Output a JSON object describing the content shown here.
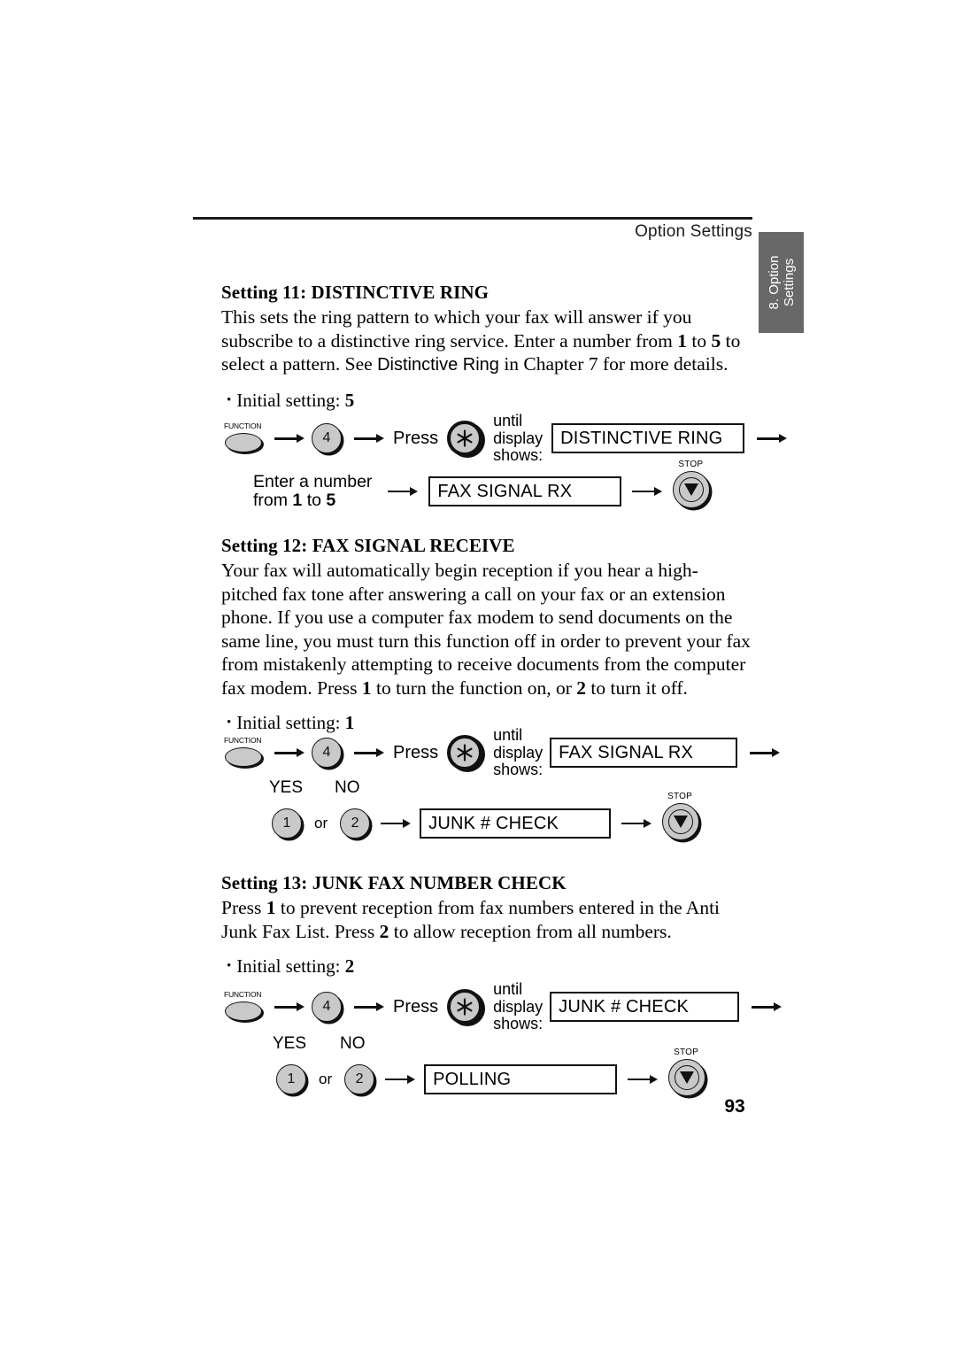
{
  "header": {
    "title": "Option Settings",
    "side_tab_line1": "8. Option",
    "side_tab_line2": "Settings",
    "tab_color": "#686868"
  },
  "page_number": "93",
  "common": {
    "function_key_label": "FUNCTION",
    "stop_key_label": "STOP",
    "press_label": "Press",
    "until_line1": "until",
    "until_line2": "display",
    "until_line3": "shows:",
    "yes_label": "YES",
    "no_label": "NO",
    "or_label": "or",
    "key_4": "4",
    "key_1": "1",
    "key_2": "2",
    "asterisk_glyph": "✱",
    "key_fill_color": "#c9c9c9",
    "key_border_color": "#111111"
  },
  "sections": [
    {
      "heading": "Setting 11: DISTINCTIVE RING",
      "body_part1": "This sets the ring pattern to which your fax will answer if you subscribe to a distinctive ring service. Enter a number from ",
      "body_bold1": "1",
      "body_part2": " to ",
      "body_bold2": "5",
      "body_part3": " to select a pattern. See ",
      "body_sans": "Distinctive Ring",
      "body_part4": " in Chapter 7 for more details.",
      "initial_label": "Initial setting:",
      "initial_value": "5",
      "flow": {
        "display1": "DISTINCTIVE RING",
        "row2_text_line1": "Enter a number",
        "row2_text_line2_pre": "from ",
        "row2_text_line2_bold1": "1",
        "row2_text_line2_mid": " to ",
        "row2_text_line2_bold2": "5",
        "display2": "FAX SIGNAL RX"
      }
    },
    {
      "heading": "Setting 12: FAX SIGNAL RECEIVE",
      "body_part1": "Your fax will automatically begin reception if you hear a high-pitched fax tone after answering a call on your fax or an extension phone. If you use a computer fax modem to send documents on the same line, you must turn this function off in order to prevent your fax from mistakenly attempting to receive documents from the computer fax modem. Press ",
      "body_bold1": "1",
      "body_part2": " to turn the function on, or ",
      "body_bold2": "2",
      "body_part3": " to turn it off.",
      "initial_label": "Initial setting:",
      "initial_value": "1",
      "flow": {
        "display1": "FAX SIGNAL RX",
        "display2": "JUNK # CHECK"
      }
    },
    {
      "heading": "Setting 13: JUNK FAX NUMBER CHECK",
      "body_part1": "Press ",
      "body_bold1": "1",
      "body_part2": " to prevent reception from fax numbers entered in the Anti Junk Fax List. Press ",
      "body_bold2": "2",
      "body_part3": " to allow reception from all numbers.",
      "initial_label": "Initial setting:",
      "initial_value": "2",
      "flow": {
        "display1": "JUNK # CHECK",
        "display2": "POLLING"
      }
    }
  ]
}
